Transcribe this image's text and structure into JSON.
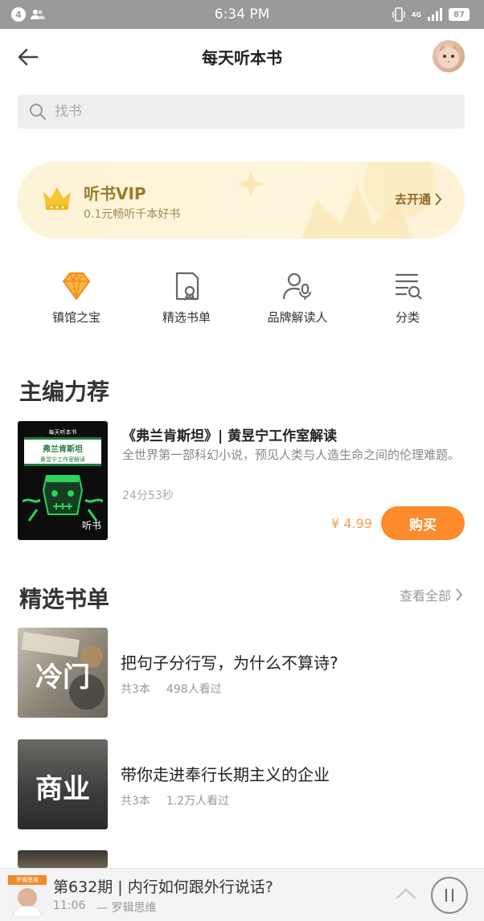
{
  "status_bar": {
    "notification_count": "4",
    "time": "6:34 PM",
    "network": "4G",
    "battery": "87"
  },
  "header": {
    "title": "每天听本书"
  },
  "search": {
    "placeholder": "找书"
  },
  "vip_banner": {
    "title": "听书VIP",
    "subtitle": "0.1元畅听千本好书",
    "action": "去开通"
  },
  "categories": [
    {
      "label": "镇馆之宝",
      "icon": "diamond-icon"
    },
    {
      "label": "精选书单",
      "icon": "booklist-icon"
    },
    {
      "label": "品牌解读人",
      "icon": "interpreter-icon"
    },
    {
      "label": "分类",
      "icon": "category-icon"
    }
  ],
  "featured": {
    "section_title": "主编力荐",
    "book": {
      "cover_top": "每天听本书",
      "cover_title": "弗兰肯斯坦",
      "cover_subtitle": "黄昱宁工作室解读",
      "cover_tag": "听书",
      "title": "《弗兰肯斯坦》| 黄昱宁工作室解读",
      "description": "全世界第一部科幻小说，预见人类与人造生命之间的伦理难题。",
      "duration": "24分53秒",
      "price": "¥ 4.99",
      "buy_label": "购买"
    }
  },
  "booklists": {
    "section_title": "精选书单",
    "see_all": "查看全部",
    "items": [
      {
        "thumb_text": "冷门",
        "title": "把句子分行写，为什么不算诗?",
        "count": "共3本",
        "views": "498人看过"
      },
      {
        "thumb_text": "商业",
        "title": "带你走进奉行长期主义的企业",
        "count": "共3本",
        "views": "1.2万人看过"
      }
    ]
  },
  "player": {
    "thumb_label": "罗辑思维",
    "title": "第632期 | 内行如何跟外行说话?",
    "time": "11:06",
    "author": "— 罗辑思维"
  },
  "colors": {
    "accent": "#fd8a2b",
    "vip_gold": "#9c7a2b",
    "status_bar": "#9a9a9a"
  }
}
